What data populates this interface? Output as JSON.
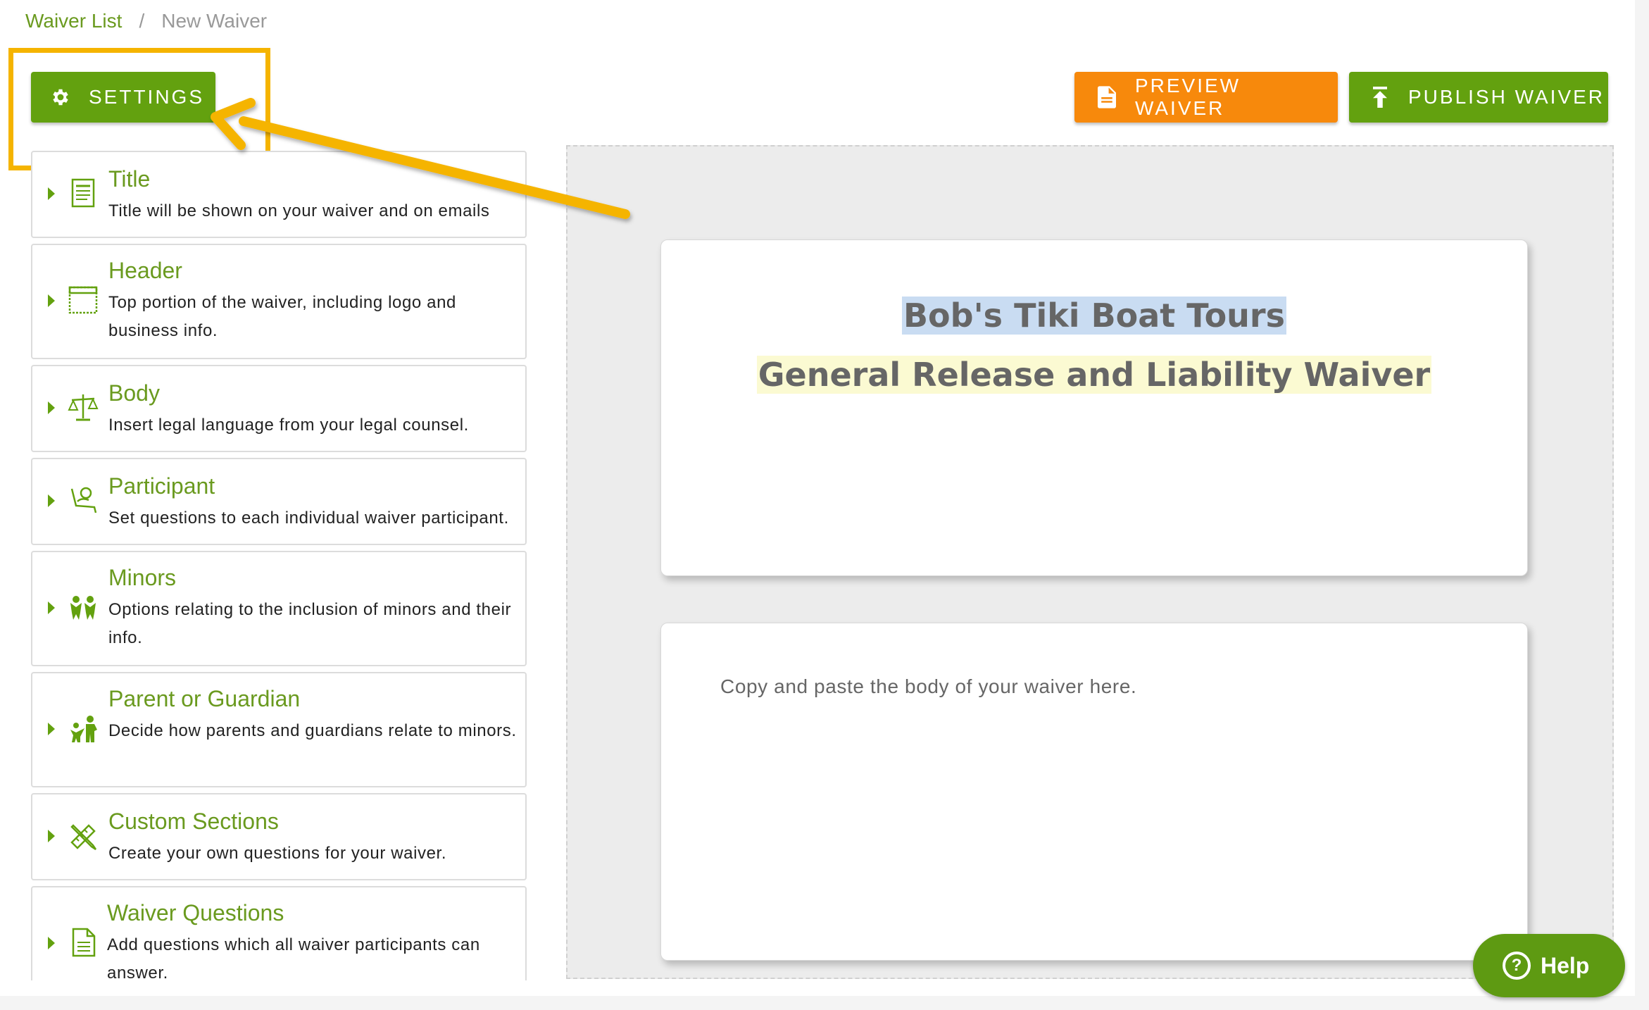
{
  "breadcrumb": {
    "items": [
      "Waiver List",
      "New Waiver"
    ],
    "separator": "/"
  },
  "toolbar": {
    "settings_label": "SETTINGS",
    "preview_label": "PREVIEW WAIVER",
    "publish_label": "PUBLISH WAIVER"
  },
  "sidebar": {
    "items": [
      {
        "title": "Title",
        "desc": "Title will be shown on your waiver and on emails",
        "icon": "document-icon"
      },
      {
        "title": "Header",
        "desc": "Top portion of the waiver, including logo and business info.",
        "icon": "window-icon"
      },
      {
        "title": "Body",
        "desc": "Insert legal language from your legal counsel.",
        "icon": "scales-icon"
      },
      {
        "title": "Participant",
        "desc": "Set questions to each individual waiver participant.",
        "icon": "person-seat-icon"
      },
      {
        "title": "Minors",
        "desc": "Options relating to the inclusion of minors and their info.",
        "icon": "children-icon"
      },
      {
        "title": "Parent or Guardian",
        "desc": "Decide how parents and guardians relate to minors.",
        "icon": "parent-child-icon"
      },
      {
        "title": "Custom Sections",
        "desc": "Create your own questions for your waiver.",
        "icon": "pencil-ruler-icon"
      },
      {
        "title": "Waiver Questions",
        "desc": "Add questions which all waiver participants can answer.",
        "icon": "file-lines-icon"
      }
    ]
  },
  "preview": {
    "business_name": "Bob's Tiki Boat Tours",
    "waiver_title": "General Release and Liability Waiver",
    "body_placeholder": "Copy and paste the body of your waiver here."
  },
  "help": {
    "label": "Help"
  },
  "colors": {
    "brand_green": "#63a10f",
    "accent_orange": "#f7890c",
    "annotation_yellow": "#f5b400"
  }
}
